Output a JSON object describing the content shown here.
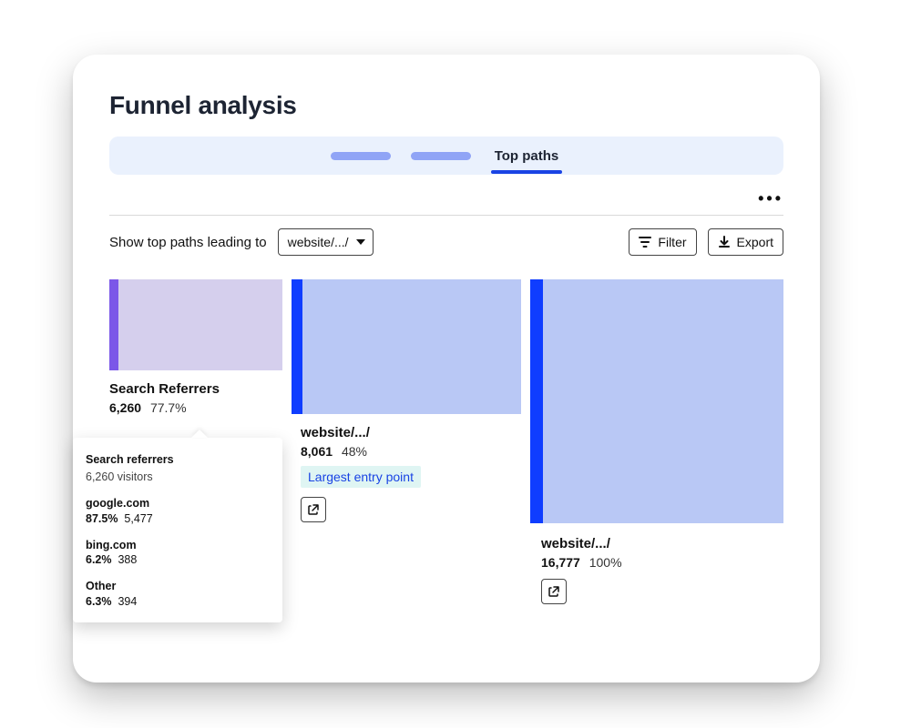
{
  "header": {
    "title": "Funnel analysis"
  },
  "tabs": {
    "active_label": "Top paths"
  },
  "toolbar": {
    "lead_text": "Show top paths leading to",
    "select_value": "website/.../",
    "filter_label": "Filter",
    "export_label": "Export"
  },
  "columns": [
    {
      "name": "Search Referrers",
      "count": "6,260",
      "percent": "77.7%"
    },
    {
      "name": "website/.../",
      "count": "8,061",
      "percent": "48%",
      "badge": "Largest entry point"
    },
    {
      "name": "website/.../",
      "count": "16,777",
      "percent": "100%"
    }
  ],
  "tooltip": {
    "title": "Search referrers",
    "subtitle": "6,260 visitors",
    "rows": [
      {
        "label": "google.com",
        "percent": "87.5%",
        "count": "5,477"
      },
      {
        "label": "bing.com",
        "percent": "6.2%",
        "count": "388"
      },
      {
        "label": "Other",
        "percent": "6.3%",
        "count": "394"
      }
    ]
  },
  "chart_data": {
    "type": "sankey",
    "note": "Three-stage path funnel; bar heights approximate relative volume at each stage.",
    "stages": [
      {
        "label": "Search Referrers",
        "value": 6260,
        "percent": 77.7
      },
      {
        "label": "website/.../",
        "value": 8061,
        "percent": 48
      },
      {
        "label": "website/.../",
        "value": 16777,
        "percent": 100
      }
    ],
    "colors": {
      "accent_bar": "#0f3dff",
      "fill_light": "#b9c8f5",
      "fill_lighter": "#d5cfed",
      "edge_purple": "#7b57e8"
    }
  }
}
